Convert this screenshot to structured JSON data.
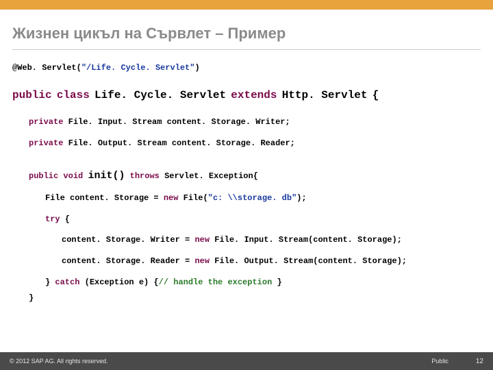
{
  "topbar_color": "#e8a33d",
  "title": "Жизнен цикъл на Сървлет – Пример",
  "code": {
    "annotation_prefix": "@Web. Servlet(",
    "annotation_url": "\"/Life. Cycle. Servlet\"",
    "annotation_close": ")",
    "kw_public": "public",
    "kw_class": "class",
    "class_name": "Life. Cycle. Servlet",
    "kw_extends": "extends",
    "super_class": "Http. Servlet",
    "open_brace": "{",
    "kw_private1": "private",
    "field1_rest": " File. Input. Stream content. Storage. Writer;",
    "kw_private2": "private",
    "field2_rest": " File. Output. Stream content. Storage. Reader;",
    "kw_public2": "public",
    "kw_void": "void",
    "method_name": "init()",
    "kw_throws": "throws",
    "throws_rest": " Servlet. Exception{",
    "file_line_a": "File content. Storage = ",
    "kw_new1": "new",
    "file_line_b": " File(",
    "file_path": "\"c: \\\\storage. db\"",
    "file_line_c": ");",
    "kw_try": "try",
    "try_brace": " {",
    "writer_a": "content. Storage. Writer = ",
    "kw_new2": "new",
    "writer_b": " File. Input. Stream(content. Storage);",
    "reader_a": "content. Storage. Reader = ",
    "kw_new3": "new",
    "reader_b": " File. Output. Stream(content. Storage);",
    "catch_a": "} ",
    "kw_catch": "catch",
    "catch_b": " (Exception e) {",
    "comment": "// handle the exception ",
    "catch_c": "}",
    "close_brace": "}"
  },
  "footer": {
    "copyright": "© 2012 SAP AG. All rights reserved.",
    "label": "Public",
    "page": "12"
  }
}
